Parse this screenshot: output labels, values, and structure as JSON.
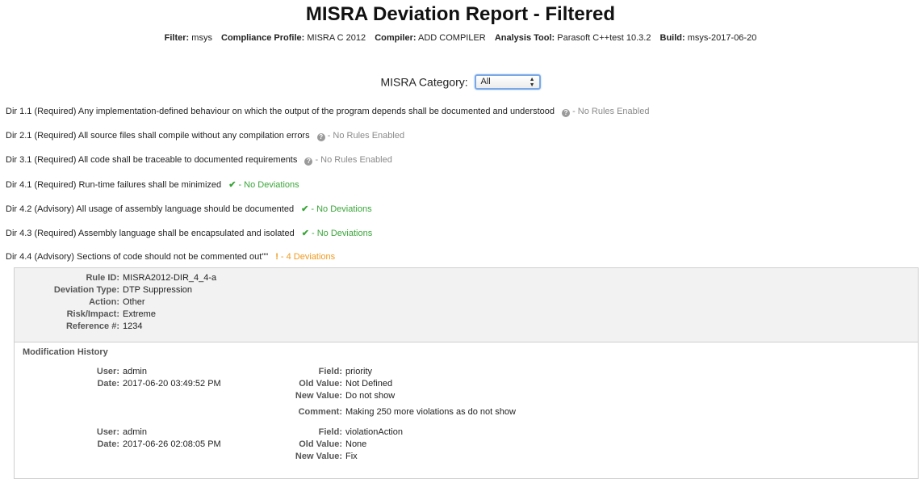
{
  "header": {
    "title": "MISRA Deviation Report - Filtered",
    "meta": [
      {
        "label": "Filter:",
        "value": "msys"
      },
      {
        "label": "Compliance Profile:",
        "value": "MISRA C 2012"
      },
      {
        "label": "Compiler:",
        "value": "ADD COMPILER"
      },
      {
        "label": "Analysis Tool:",
        "value": "Parasoft C++test 10.3.2"
      },
      {
        "label": "Build:",
        "value": "msys-2017-06-20"
      }
    ]
  },
  "category_filter": {
    "label": "MISRA Category:",
    "selected": "All"
  },
  "directives": [
    {
      "text": "Dir 1.1 (Required) Any implementation-defined behaviour on which the output of the program depends shall be documented and understood",
      "status": "- No Rules Enabled",
      "kind": "norules",
      "icon": "question-icon"
    },
    {
      "text": "Dir 2.1 (Required) All source files shall compile without any compilation errors",
      "status": "- No Rules Enabled",
      "kind": "norules",
      "icon": "question-icon"
    },
    {
      "text": "Dir 3.1 (Required) All code shall be traceable to documented requirements",
      "status": "- No Rules Enabled",
      "kind": "norules",
      "icon": "question-icon"
    },
    {
      "text": "Dir 4.1 (Required) Run-time failures shall be minimized",
      "status": "- No Deviations",
      "kind": "ok",
      "icon": "check-icon"
    },
    {
      "text": "Dir 4.2 (Advisory) All usage of assembly language should be documented",
      "status": "- No Deviations",
      "kind": "ok",
      "icon": "check-icon"
    },
    {
      "text": "Dir 4.3 (Required) Assembly language shall be encapsulated and isolated",
      "status": "- No Deviations",
      "kind": "ok",
      "icon": "check-icon"
    },
    {
      "text": "Dir 4.4 (Advisory) Sections of code should not be commented out\"\"",
      "status": "- 4 Deviations",
      "kind": "warn",
      "icon": "exclamation-icon"
    }
  ],
  "deviation": {
    "rule_id_label": "Rule ID:",
    "rule_id": "MISRA2012-DIR_4_4-a",
    "type_label": "Deviation Type:",
    "type": "DTP Suppression",
    "action_label": "Action:",
    "action": "Other",
    "risk_label": "Risk/Impact:",
    "risk": "Extreme",
    "ref_label": "Reference #:",
    "ref": "1234"
  },
  "history": {
    "title": "Modification History",
    "entries": [
      {
        "user_label": "User:",
        "user": "admin",
        "date_label": "Date:",
        "date": "2017-06-20 03:49:52 PM",
        "field_label": "Field:",
        "field": "priority",
        "old_label": "Old Value:",
        "old": "Not Defined",
        "new_label": "New Value:",
        "new": "Do not show",
        "comment_label": "Comment:",
        "comment": "Making 250 more violations as do not show"
      },
      {
        "user_label": "User:",
        "user": "admin",
        "date_label": "Date:",
        "date": "2017-06-26 02:08:05 PM",
        "field_label": "Field:",
        "field": "violationAction",
        "old_label": "Old Value:",
        "old": "None",
        "new_label": "New Value:",
        "new": "Fix"
      }
    ]
  },
  "colors": {
    "no_rules": "#8a8a8a",
    "no_deviations": "#3aa53a",
    "deviations": "#ef9a1f",
    "panel_bg": "#f2f2f2"
  }
}
